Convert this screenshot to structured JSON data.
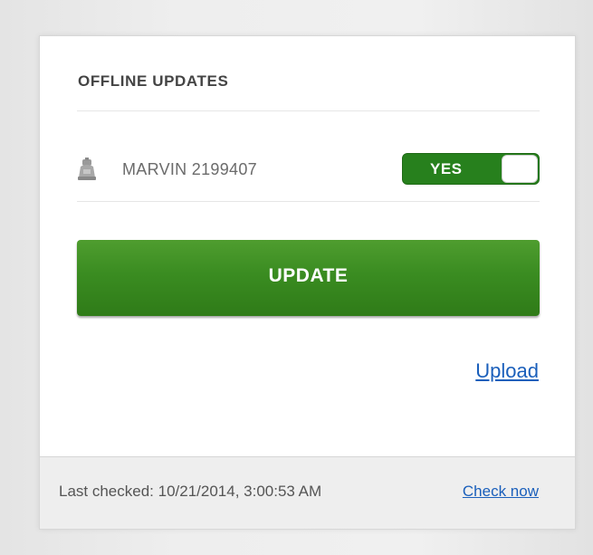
{
  "panel": {
    "title": "OFFLINE UPDATES"
  },
  "device": {
    "icon": "robot-icon",
    "name": "MARVIN 2199407",
    "toggle_label": "YES",
    "toggle_on": true
  },
  "actions": {
    "update_label": "UPDATE",
    "upload_label": "Upload"
  },
  "footer": {
    "last_checked": "Last checked: 10/21/2014, 3:00:53 AM",
    "check_now_label": "Check now"
  },
  "colors": {
    "accent_green": "#2f7b18",
    "link_blue": "#1a5fbb"
  }
}
